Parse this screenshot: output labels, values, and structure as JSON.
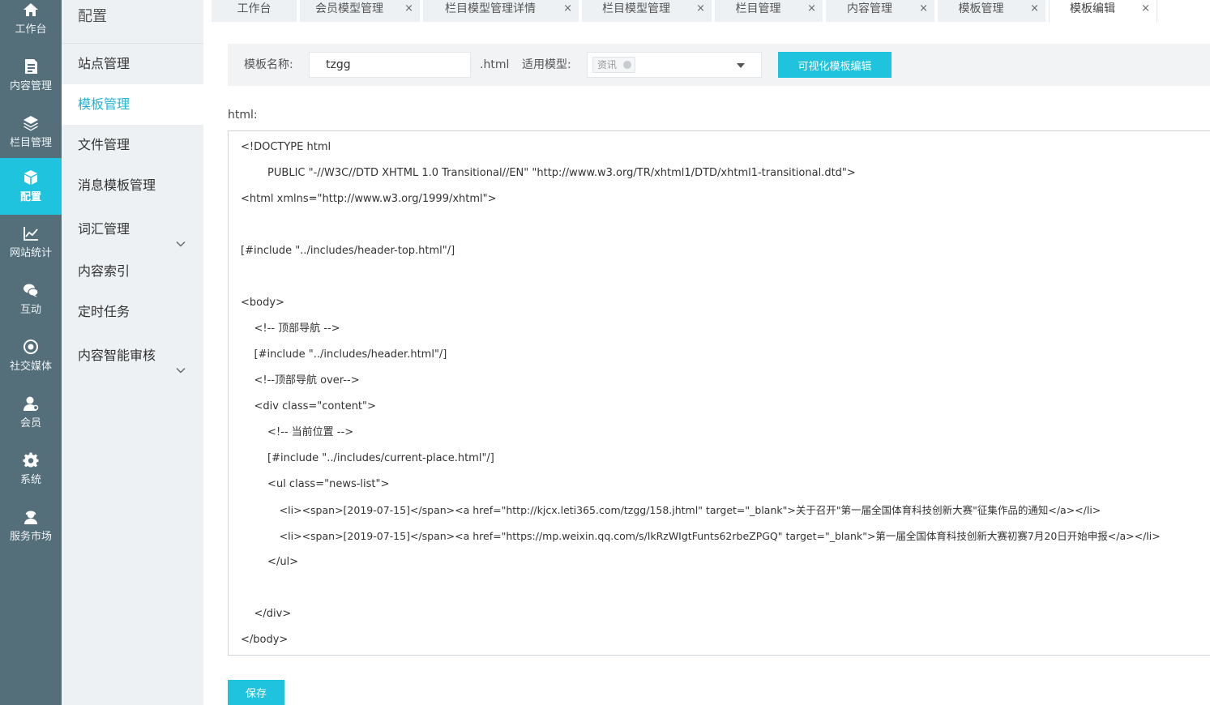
{
  "rail": [
    {
      "label": "工作台",
      "icon": "home-icon"
    },
    {
      "label": "内容管理",
      "icon": "document-icon"
    },
    {
      "label": "栏目管理",
      "icon": "layers-icon"
    },
    {
      "label": "配置",
      "icon": "cube-icon",
      "active": true
    },
    {
      "label": "网站统计",
      "icon": "chart-icon"
    },
    {
      "label": "互动",
      "icon": "chat-icon"
    },
    {
      "label": "社交媒体",
      "icon": "target-icon"
    },
    {
      "label": "会员",
      "icon": "user-icon"
    },
    {
      "label": "系统",
      "icon": "gear-icon"
    },
    {
      "label": "服务市场",
      "icon": "service-icon"
    }
  ],
  "sidebar": {
    "title": "配置",
    "items": [
      {
        "label": "站点管理"
      },
      {
        "label": "模板管理",
        "active": true
      },
      {
        "label": "文件管理"
      },
      {
        "label": "消息模板管理"
      },
      {
        "label": "词汇管理",
        "expandable": true
      },
      {
        "label": "内容索引"
      },
      {
        "label": "定时任务"
      },
      {
        "label": "内容智能审核",
        "expandable": true
      }
    ]
  },
  "tabs": [
    {
      "label": "工作台"
    },
    {
      "label": "会员模型管理",
      "close": "×"
    },
    {
      "label": "栏目模型管理详情",
      "close": "×"
    },
    {
      "label": "栏目模型管理",
      "close": "×"
    },
    {
      "label": "栏目管理",
      "close": "×"
    },
    {
      "label": "内容管理",
      "close": "×"
    },
    {
      "label": "模板管理",
      "close": "×"
    },
    {
      "label": "模板编辑",
      "close": "×",
      "active": true
    }
  ],
  "form": {
    "name_label": "模板名称:",
    "name_value": "tzgg",
    "suffix": ".html",
    "model_label": "适用模型:",
    "model_chip": "资讯",
    "visual_button": "可视化模板编辑"
  },
  "editor": {
    "label": "html:",
    "lines": [
      "<!DOCTYPE html",
      "        PUBLIC \"-//W3C//DTD XHTML 1.0 Transitional//EN\" \"http://www.w3.org/TR/xhtml1/DTD/xhtml1-transitional.dtd\">",
      "<html xmlns=\"http://www.w3.org/1999/xhtml\">",
      "",
      "[#include \"../includes/header-top.html\"/]",
      "",
      "<body>",
      "    <!-- 顶部导航 -->",
      "    [#include \"../includes/header.html\"/]",
      "    <!--顶部导航 over-->",
      "    <div class=\"content\">",
      "        <!-- 当前位置 -->",
      "        [#include \"../includes/current-place.html\"/]",
      "        <ul class=\"news-list\">",
      "            <li><span>[2019-07-15]</span><a href=\"http://kjcx.leti365.com/tzgg/158.jhtml\" target=\"_blank\">关于召开\"第一届全国体育科技创新大赛\"征集作品的通知</a></li>",
      "            <li><span>[2019-07-15]</span><a href=\"https://mp.weixin.qq.com/s/lkRzWIgtFunts62rbeZPGQ\" target=\"_blank\">第一届全国体育科技创新大赛初赛7月20日开始申报</a></li>",
      "        </ul>",
      "",
      "    </div>",
      "</body>"
    ]
  },
  "save_button": "保存",
  "colors": {
    "rail_bg": "#546e7a",
    "accent": "#1fc3dd",
    "sidebar_bg": "#eef1f3",
    "active_text": "#1fb5d4"
  }
}
